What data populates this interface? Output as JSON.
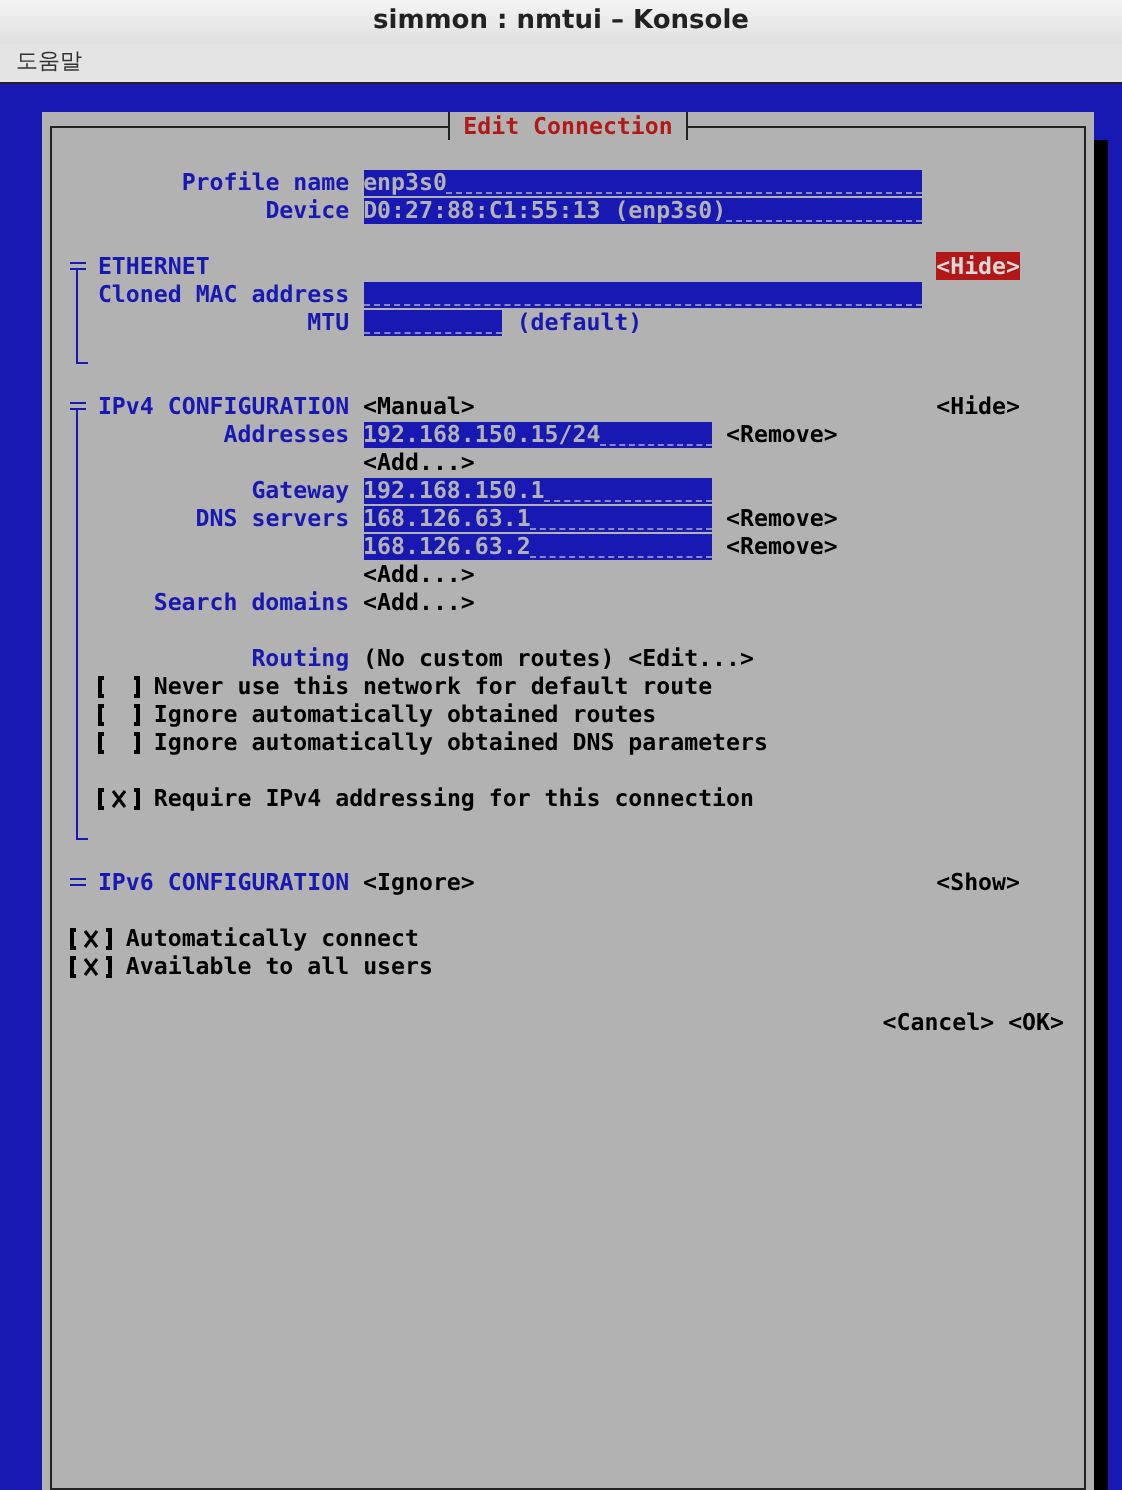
{
  "window": {
    "title": "simmon : nmtui – Konsole"
  },
  "menu": [
    "도움말"
  ],
  "dialog": {
    "title": "Edit Connection",
    "fields": [
      {
        "kind": "wide",
        "label": "Profile name",
        "value": "enp3s0"
      },
      {
        "kind": "wide",
        "label": "Device",
        "value": "D0:27:88:C1:55:13 (enp3s0)"
      }
    ],
    "sections": [
      {
        "title": "ETHERNET",
        "expanded": true,
        "toggle": {
          "label": "<Hide>",
          "focused": true
        },
        "rows": [
          {
            "kind": "wide",
            "label": "Cloned MAC address"
          },
          {
            "kind": "short",
            "label": "MTU",
            "note": "(default)"
          }
        ]
      },
      {
        "title": "IPv4 CONFIGURATION",
        "mode": "<Manual>",
        "expanded": true,
        "toggle": {
          "label": "<Hide>",
          "focused": false
        },
        "rows": [
          {
            "kind": "medium",
            "label": "Addresses",
            "value": "192.168.150.15/24",
            "action": "<Remove>"
          },
          {
            "kind": "button",
            "button": "<Add...>"
          },
          {
            "kind": "medium",
            "label": "Gateway",
            "value": "192.168.150.1"
          },
          {
            "kind": "medium",
            "label": "DNS servers",
            "value": "168.126.63.1",
            "action": "<Remove>"
          },
          {
            "kind": "medium",
            "value": "168.126.63.2",
            "action": "<Remove>"
          },
          {
            "kind": "button",
            "button": "<Add...>"
          },
          {
            "kind": "button",
            "label": "Search domains",
            "button": "<Add...>"
          },
          {
            "kind": "spacer"
          },
          {
            "kind": "routing",
            "label": "Routing",
            "value": "(No custom routes)",
            "button": "<Edit...>"
          },
          {
            "kind": "checkbox",
            "label": "Never use this network for default route",
            "checked": false
          },
          {
            "kind": "checkbox",
            "label": "Ignore automatically obtained routes",
            "checked": false
          },
          {
            "kind": "checkbox",
            "label": "Ignore automatically obtained DNS parameters",
            "checked": false
          },
          {
            "kind": "spacer"
          },
          {
            "kind": "checkbox",
            "label": "Require IPv4 addressing for this connection",
            "checked": true
          }
        ]
      },
      {
        "title": "IPv6 CONFIGURATION",
        "mode": "<Ignore>",
        "expanded": false,
        "toggle": {
          "label": "<Show>",
          "focused": false
        }
      }
    ],
    "options": [
      {
        "label": "Automatically connect",
        "checked": true
      },
      {
        "label": "Available to all users",
        "checked": true
      }
    ],
    "buttons": [
      "<Cancel>",
      "<OK>"
    ]
  }
}
